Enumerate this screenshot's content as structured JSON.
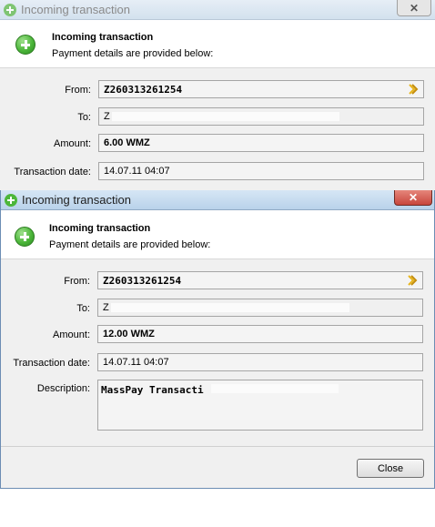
{
  "window1": {
    "title": "Incoming transaction",
    "close_glyph": "✕",
    "header_title": "Incoming transaction",
    "header_subtitle": "Payment details are provided below:",
    "fields": {
      "from_label": "From:",
      "from_value": "Z260313261254",
      "to_label": "To:",
      "to_value": "Z",
      "amount_label": "Amount:",
      "amount_value": "6.00 WMZ",
      "date_label": "Transaction date:",
      "date_value": "14.07.11 04:07"
    }
  },
  "window2": {
    "title": "Incoming transaction",
    "close_glyph": "✕",
    "header_title": "Incoming transaction",
    "header_subtitle": "Payment details are provided below:",
    "fields": {
      "from_label": "From:",
      "from_value": "Z260313261254",
      "to_label": "To:",
      "to_value": "Z",
      "amount_label": "Amount:",
      "amount_value": "12.00 WMZ",
      "date_label": "Transaction date:",
      "date_value": "14.07.11 04:07",
      "description_label": "Description:",
      "description_value": "MassPay Transacti"
    },
    "close_button_label": "Close"
  },
  "icons": {
    "title_icon": "green-plus-circle-icon",
    "header_icon": "green-plus-circle-icon",
    "from_arrow": "double-chevron-right-icon"
  },
  "colors": {
    "titlebar_inactive": "#dbe8f3",
    "titlebar_active": "#c3daf0",
    "close_red": "#c7463c",
    "icon_green": "#4cb63a",
    "arrow_yellow": "#e8b51a"
  }
}
